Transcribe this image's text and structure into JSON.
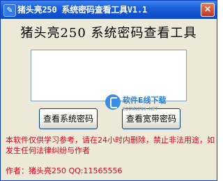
{
  "window": {
    "title": "猪头亮250  系统密码查看工具V1.1",
    "close_label": "×"
  },
  "main": {
    "heading": "猪头亮250  系统密码查看工具",
    "output_value": "",
    "buttons": {
      "view_system_password": "查看系统密码",
      "view_broadband_password": "查看宽带密码"
    },
    "notice": "本软件仅供学习参考，请在24小时内删除，禁止非法用途，如发生任何法律纠纷与作者",
    "author": "作者：猪头亮250 QQ:11565556"
  },
  "watermark": {
    "text": "软件E线下载",
    "subtext": "EDOWNING.NET"
  },
  "colors": {
    "titlebar": "#0a49c8",
    "notice_text": "#e0001b",
    "watermark": "#2f7fd7"
  }
}
